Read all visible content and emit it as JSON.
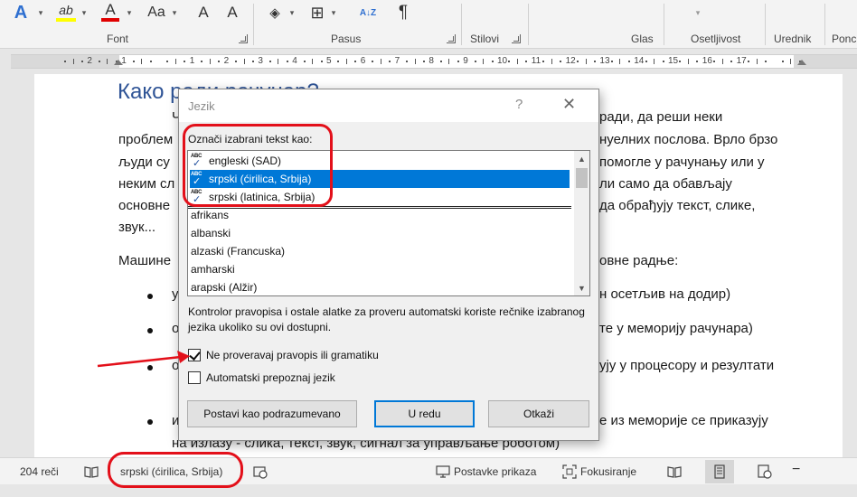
{
  "ribbon": {
    "groups": {
      "font": "Font",
      "paragraph": "Pasus",
      "styles": "Stilovi",
      "voice": "Glas",
      "sensitivity": "Osetljivost",
      "editor": "Urednik",
      "reuse": "Ponc"
    },
    "icons": {
      "text_effects": "A",
      "highlight": "ab",
      "font_color": "A",
      "change_case": "Aa",
      "grow_font": "A",
      "shrink_font": "A",
      "sort": "A↓Z",
      "pilcrow": "¶"
    }
  },
  "ruler": {
    "numbers": [
      "2",
      "1",
      "1",
      "2",
      "3",
      "4",
      "5",
      "6",
      "7",
      "8",
      "9",
      "10",
      "11",
      "12",
      "13",
      "14",
      "15",
      "16",
      "17"
    ]
  },
  "document": {
    "heading": "Како ради рачунар?",
    "lines": [
      "Ч",
      "ради, да реши неки",
      "проблем",
      "нуелних послова. Врло брзо",
      "људи су",
      "помогле у рачунању или у",
      "неким сл",
      "ли само да обављају",
      "основне",
      "да обрађују текст, слике,",
      "звук...",
      "Машине",
      "овне радње:",
      "у",
      "н осетљив на додир)",
      "о",
      "те у меморију рачунара)",
      "о",
      "ују у процесору и резултати",
      "и",
      "е из меморије се приказују",
      "на излазу - слика, текст, звук, сигнал за управљање роботом)"
    ]
  },
  "dialog": {
    "title": "Jezik",
    "help": "?",
    "close": "✕",
    "label": "Označi izabrani tekst kao:",
    "languages_top": [
      "engleski (SAD)",
      "srpski (ćirilica, Srbija)",
      "srpski (latinica, Srbija)"
    ],
    "languages_all": [
      "afrikans",
      "albanski",
      "alzaski (Francuska)",
      "amharski",
      "arapski (Alžir)"
    ],
    "info": "Kontrolor pravopisa i ostale alatke za proveru automatski koriste rečnike izabranog jezika ukoliko su ovi dostupni.",
    "checkbox_no_proof": "Ne proveravaj pravopis ili gramatiku",
    "checkbox_no_proof_checked": true,
    "checkbox_detect": "Automatski prepoznaj jezik",
    "checkbox_detect_checked": false,
    "btn_default": "Postavi kao podrazumevano",
    "btn_ok": "U redu",
    "btn_cancel": "Otkaži"
  },
  "statusbar": {
    "word_count": "204 reči",
    "language": "srpski (ćirilica, Srbija)",
    "display_settings": "Postavke prikaza",
    "focus": "Fokusiranje"
  },
  "colors": {
    "accent": "#0078d7",
    "annotation_red": "#e3101a",
    "heading_blue": "#2f5496"
  }
}
